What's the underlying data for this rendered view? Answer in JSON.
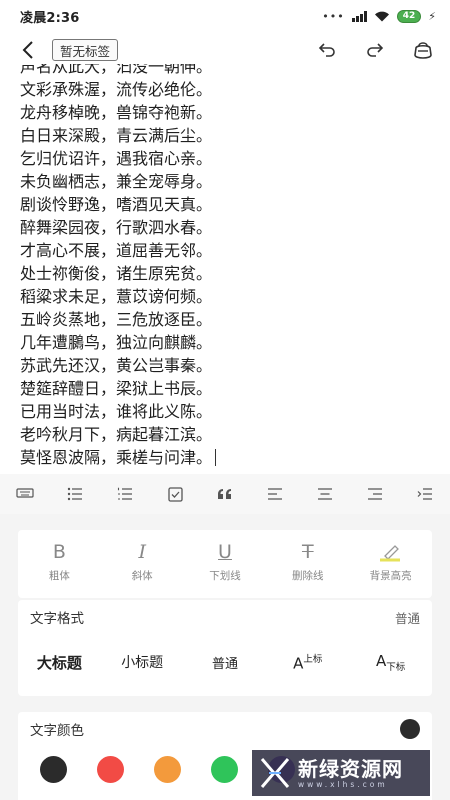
{
  "status_bar": {
    "time": "凌晨2:36",
    "battery": "42"
  },
  "app_bar": {
    "tag_label": "暂无标签",
    "icons": [
      "back-arrow-icon",
      "undo-icon",
      "redo-icon",
      "bag-icon"
    ]
  },
  "editor": {
    "lines": [
      "声名从此大，汩没一朝伸。",
      "文彩承殊渥，流传必绝伦。",
      "龙舟移棹晚，兽锦夺袍新。",
      "白日来深殿，青云满后尘。",
      "乞归优诏许，遇我宿心亲。",
      "未负幽栖志，兼全宠辱身。",
      "剧谈怜野逸，嗜酒见天真。",
      "醉舞梁园夜，行歌泗水春。",
      "才高心不展，道屈善无邻。",
      "处士祢衡俊，诸生原宪贫。",
      "稻粱求未足，薏苡谤何频。",
      "五岭炎蒸地，三危放逐臣。",
      "几年遭鵩鸟，独泣向麒麟。",
      "苏武先还汉，黄公岂事秦。",
      "楚筵辞醴日，梁狱上书辰。",
      "已用当时法，谁将此义陈。",
      "老吟秋月下，病起暮江滨。",
      "莫怪恩波隔，乘槎与问津。"
    ]
  },
  "toolbar": {
    "icons": [
      "keyboard-icon",
      "bullet-list-icon",
      "numbered-list-icon",
      "checkbox-icon",
      "quote-icon",
      "align-left-icon",
      "align-center-icon",
      "align-right-icon",
      "indent-icon"
    ]
  },
  "text_style": {
    "bold": {
      "glyph": "B",
      "label": "粗体"
    },
    "italic": {
      "glyph": "I",
      "label": "斜体"
    },
    "underline": {
      "glyph": "U",
      "label": "下划线"
    },
    "strike": {
      "glyph": "T",
      "label": "删除线"
    },
    "highlight": {
      "label": "背景高亮"
    }
  },
  "text_format": {
    "title": "文字格式",
    "current": "普通",
    "options": {
      "h1": "大标题",
      "h2": "小标题",
      "normal": "普通",
      "sup_base": "A",
      "sup_label": "上标",
      "sub_base": "A",
      "sub_label": "下标"
    }
  },
  "text_color": {
    "title": "文字颜色",
    "current_color": "#2b2b2b",
    "swatches": [
      "#2b2b2b",
      "#f24b45",
      "#f39a3c",
      "#2fc45a",
      "#8a5fd8"
    ]
  },
  "watermark": {
    "text": "新绿资源网",
    "url": "www.xlhs.com"
  }
}
